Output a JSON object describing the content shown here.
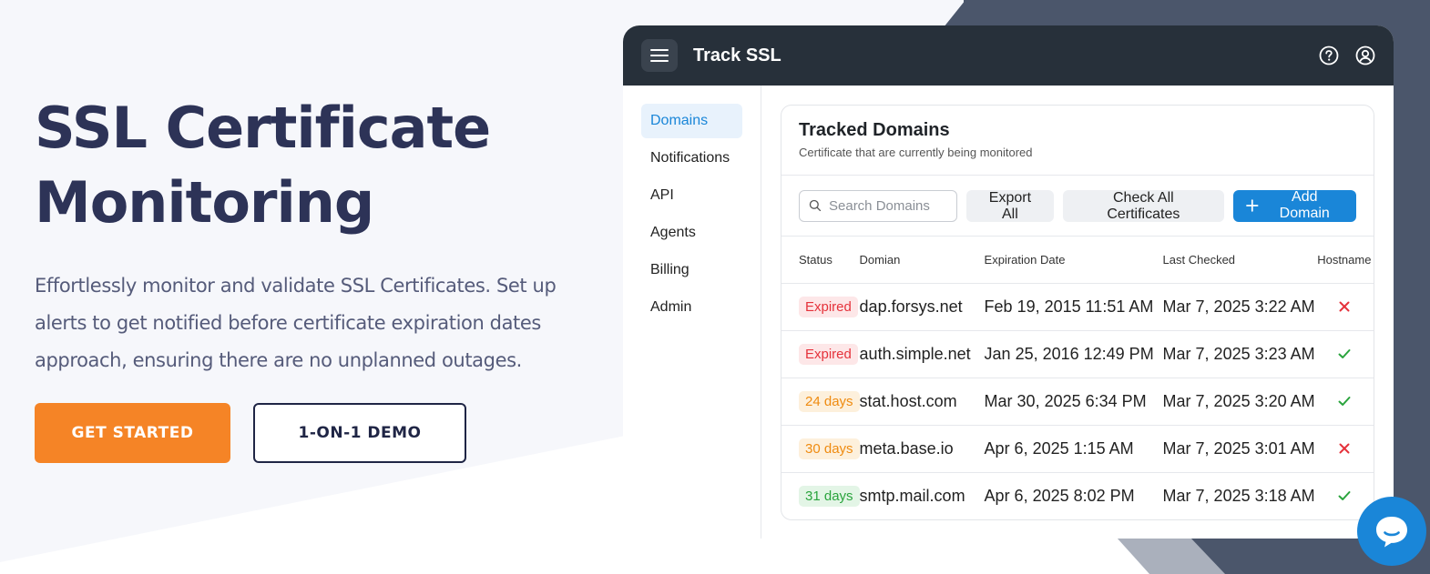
{
  "hero": {
    "title_line1": "SSL Certificate",
    "title_line2": "Monitoring",
    "description": "Effortlessly monitor and validate SSL Certificates. Set up alerts to get notified before certificate expiration dates approach, ensuring there are no unplanned outages.",
    "primary_cta": "GET STARTED",
    "secondary_cta": "1-ON-1 DEMO"
  },
  "app": {
    "title": "Track SSL",
    "sidebar": [
      {
        "label": "Domains",
        "active": true
      },
      {
        "label": "Notifications",
        "active": false
      },
      {
        "label": "API",
        "active": false
      },
      {
        "label": "Agents",
        "active": false
      },
      {
        "label": "Billing",
        "active": false
      },
      {
        "label": "Admin",
        "active": false
      }
    ],
    "card": {
      "title": "Tracked Domains",
      "subtitle": "Certificate that are currently being monitored",
      "search_placeholder": "Search Domains",
      "export_label": "Export All",
      "check_label": "Check All Certificates",
      "add_label": "Add Domain"
    },
    "table": {
      "headers": [
        "Status",
        "Domian",
        "Expiration Date",
        "Last Checked",
        "Hostname"
      ],
      "rows": [
        {
          "status": "Expired",
          "domain": "dap.forsys.net",
          "expiration": "Feb 19, 2015 11:51 AM",
          "checked": "Mar 7, 2025 3:22 AM",
          "hostname_ok": false
        },
        {
          "status": "Expired",
          "domain": "auth.simple.net",
          "expiration": "Jan 25, 2016 12:49 PM",
          "checked": "Mar 7, 2025 3:23 AM",
          "hostname_ok": true
        },
        {
          "status": "24 days",
          "domain": "stat.host.com",
          "expiration": "Mar 30, 2025 6:34 PM",
          "checked": "Mar 7, 2025 3:20 AM",
          "hostname_ok": true
        },
        {
          "status": "30 days",
          "domain": "meta.base.io",
          "expiration": "Apr 6, 2025 1:15 AM",
          "checked": "Mar 7, 2025 3:01 AM",
          "hostname_ok": false
        },
        {
          "status": "31 days",
          "domain": "smtp.mail.com",
          "expiration": "Apr 6, 2025 8:02 PM",
          "checked": "Mar 7, 2025 3:18 AM",
          "hostname_ok": true
        }
      ]
    }
  },
  "colors": {
    "accent_orange": "#f58426",
    "brand_blue": "#1a86d8",
    "navy": "#2d3357",
    "expired_bg": "#fde7e8",
    "expired_fg": "#e5323b",
    "warn_bg": "#fdf0dc",
    "warn_fg": "#ef8b10",
    "ok_bg": "#e3f5e6",
    "ok_fg": "#2aa43d"
  }
}
